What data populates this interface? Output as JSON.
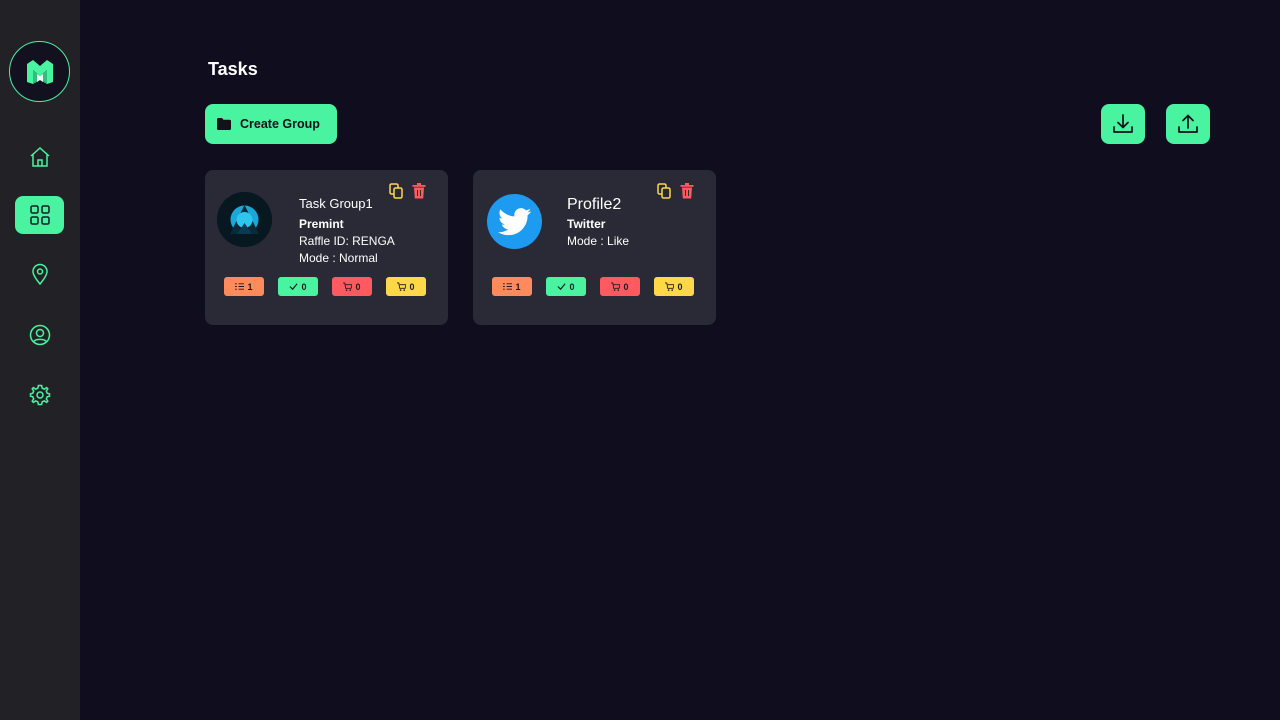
{
  "page": {
    "title": "Tasks"
  },
  "toolbar": {
    "create_label": "Create Group",
    "create_icon": "folder-icon",
    "import_icon": "download-icon",
    "export_icon": "upload-icon"
  },
  "sidebar": {
    "logo_icon": "m-logo",
    "items": [
      {
        "name": "home",
        "icon": "home-icon",
        "active": false
      },
      {
        "name": "tasks",
        "icon": "grid-icon",
        "active": true
      },
      {
        "name": "locations",
        "icon": "map-pin-icon",
        "active": false
      },
      {
        "name": "profile",
        "icon": "user-circle-icon",
        "active": false
      },
      {
        "name": "settings",
        "icon": "gear-icon",
        "active": false
      }
    ]
  },
  "groups": [
    {
      "title": "Task Group1",
      "subtitle": "Premint",
      "raffle": "Raffle ID: RENGA",
      "mode": "Mode : Normal",
      "avatar": "premint-logo",
      "badges": {
        "tasks": "1",
        "success": "0",
        "failed": "0",
        "carted": "0"
      }
    },
    {
      "title": "Profile2",
      "subtitle": "Twitter",
      "mode": "Mode : Like",
      "avatar": "twitter-logo",
      "badges": {
        "tasks": "1",
        "success": "0",
        "failed": "0",
        "carted": "0"
      }
    }
  ],
  "colors": {
    "accent": "#4af3a0",
    "background": "#100d1f",
    "sidebar": "#222226",
    "card": "#2a2a36",
    "badge_tasks": "#ff8a5c",
    "badge_success": "#4af3a0",
    "badge_failed": "#ff5a5f",
    "badge_carted": "#ffd84a",
    "copy_icon": "#ffd84a",
    "delete_icon": "#ff5a5f"
  }
}
